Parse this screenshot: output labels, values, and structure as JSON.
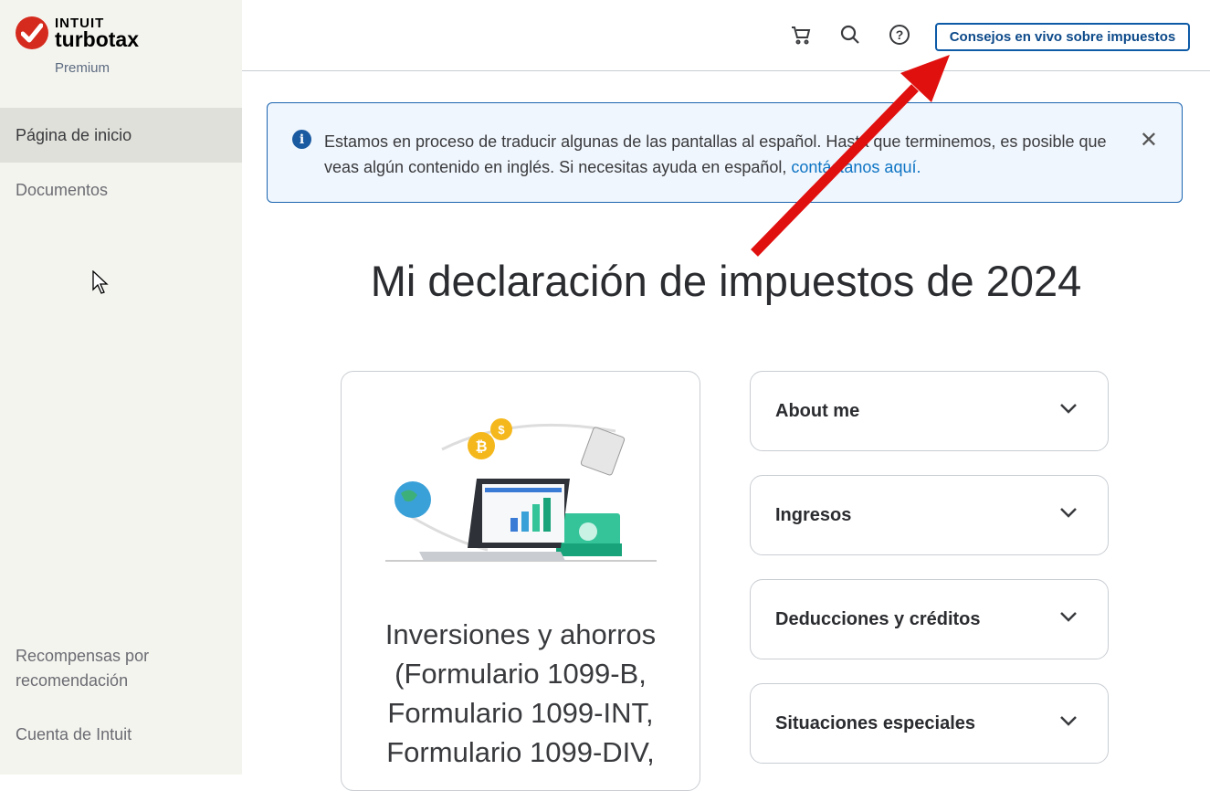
{
  "brand": {
    "company": "INTUIT",
    "product": "turbotax",
    "tier": "Premium"
  },
  "sidebar": {
    "items": [
      {
        "label": "Página de inicio"
      },
      {
        "label": "Documentos"
      }
    ],
    "bottom": [
      {
        "label": "Recompensas por recomendación"
      },
      {
        "label": "Cuenta de Intuit"
      }
    ]
  },
  "topbar": {
    "live_button": "Consejos en vivo sobre impuestos"
  },
  "banner": {
    "text": "Estamos en proceso de traducir algunas de las pantallas al español. Hasta que terminemos, es posible que veas algún contenido en inglés. Si necesitas ayuda en español, ",
    "link": "contáctanos aquí."
  },
  "main": {
    "title": "Mi declaración de impuestos de 2024",
    "card_title": "Inversiones y ahorros (Formulario 1099-B, Formulario 1099-INT, Formulario 1099-DIV,",
    "sections": [
      {
        "label": "About me"
      },
      {
        "label": "Ingresos"
      },
      {
        "label": "Deducciones y créditos"
      },
      {
        "label": "Situaciones especiales"
      }
    ]
  },
  "colors": {
    "accent": "#0d5aa7",
    "brand_red": "#d52b1e",
    "sidebar_bg": "#f4f4ef"
  }
}
